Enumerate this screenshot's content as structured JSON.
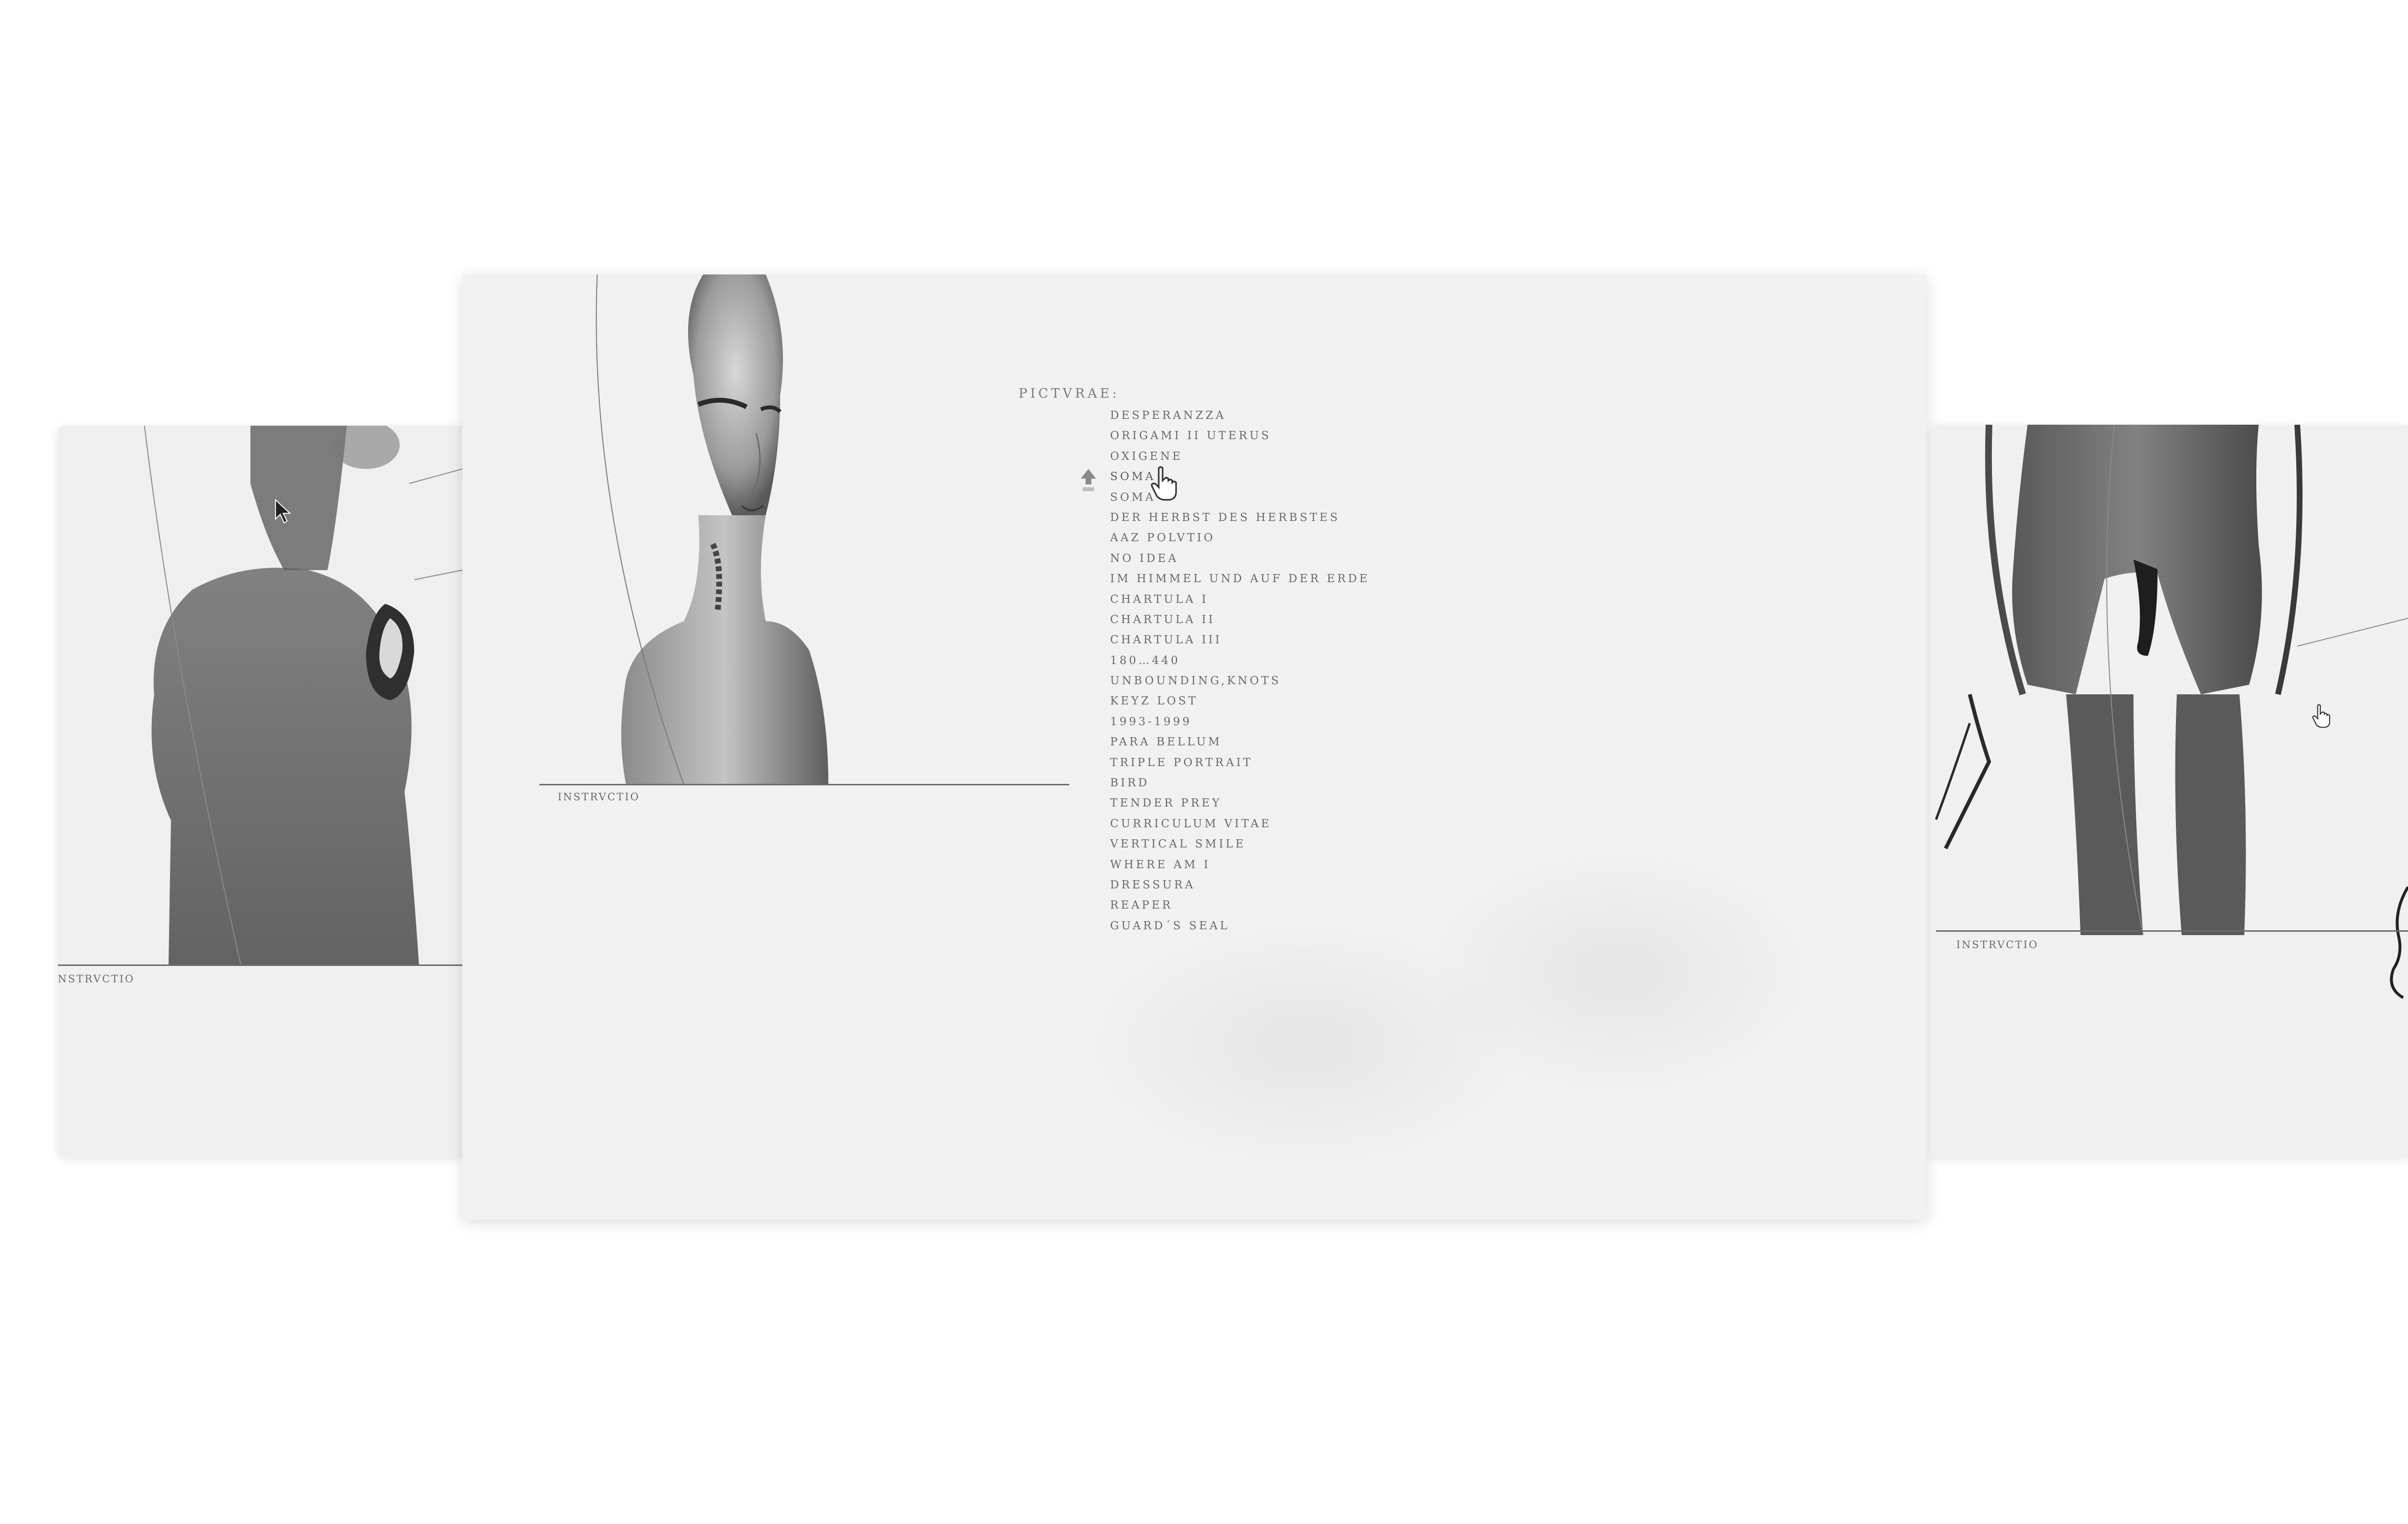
{
  "left_panel": {
    "caption": "NSTRVCTIO"
  },
  "center_panel": {
    "caption": "INSTRVCTIO",
    "menu": {
      "title": "PICTVRAE:",
      "items": [
        "DESPERANZZA",
        "ORIGAMI II UTERUS",
        "OXIGENE",
        "SOMA",
        "SOMA",
        "DER HERBST DES HERBSTES",
        "AAZ POLVTIO",
        "NO IDEA",
        "IM HIMMEL UND AUF DER ERDE",
        "CHARTULA I",
        "CHARTULA II",
        "CHARTULA III",
        "180…440",
        "UNBOUNDING,KNOTS",
        "KEYZ LOST",
        "1993-1999",
        "PARA BELLUM",
        "TRIPLE PORTRAIT",
        "BIRD",
        "TENDER PREY",
        "CURRICULUM VITAE",
        "VERTICAL SMILE",
        "WHERE AM I",
        "DRESSURA",
        "REAPER",
        "GUARD´S SEAL"
      ],
      "active_index": 3
    }
  },
  "right_panel": {
    "caption": "INSTRVCTIO"
  },
  "icons": {
    "cursor": "hand-pointer-icon",
    "up": "up-arrow-icon",
    "arrow": "mouse-arrow-icon"
  }
}
